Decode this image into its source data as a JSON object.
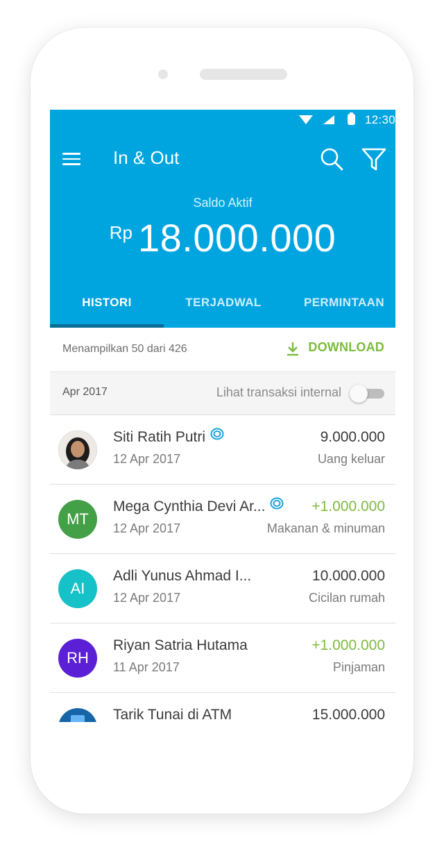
{
  "status_bar": {
    "time": "12:30",
    "icons": [
      "wifi-icon",
      "signal-icon",
      "battery-icon"
    ]
  },
  "toolbar": {
    "title": "In & Out",
    "menu_icon": "menu-icon",
    "search_icon": "search-icon",
    "filter_icon": "filter-icon"
  },
  "balance": {
    "label": "Saldo Aktif",
    "currency": "Rp",
    "amount": "18.000.000"
  },
  "tabs": [
    {
      "label": "HISTORI",
      "active": true
    },
    {
      "label": "TERJADWAL",
      "active": false
    },
    {
      "label": "PERMINTAAN",
      "active": false
    }
  ],
  "summary": {
    "count_text": "Menampilkan 50 dari 426",
    "download_label": "DOWNLOAD",
    "download_icon": "download-icon"
  },
  "section": {
    "month": "Apr 2017",
    "internal_label": "Lihat transaksi internal",
    "toggle_on": false
  },
  "transactions": [
    {
      "name": "Siti Ratih Putri",
      "verified": true,
      "date": "12 Apr 2017",
      "amount": "9.000.000",
      "direction": "out",
      "category": "Uang keluar",
      "avatar_initials": "",
      "avatar_type": "photo"
    },
    {
      "name": "Mega Cynthia Devi Ar...",
      "verified": true,
      "date": "12 Apr 2017",
      "amount": "+1.000.000",
      "direction": "in",
      "category": "Makanan & minuman",
      "avatar_initials": "MT",
      "avatar_color": "#43a047"
    },
    {
      "name": "Adli Yunus Ahmad I...",
      "verified": false,
      "date": "12 Apr 2017",
      "amount": "10.000.000",
      "direction": "out",
      "category": "Cicilan rumah",
      "avatar_initials": "AI",
      "avatar_color": "#16c1c8"
    },
    {
      "name": "Riyan Satria Hutama",
      "verified": false,
      "date": "11 Apr 2017",
      "amount": "+1.000.000",
      "direction": "in",
      "category": "Pinjaman",
      "avatar_initials": "RH",
      "avatar_color": "#5b1fd6"
    },
    {
      "name": "Tarik Tunai di ATM",
      "verified": false,
      "date": "",
      "amount": "15.000.000",
      "direction": "out",
      "category": "",
      "avatar_initials": "",
      "avatar_type": "atm-icon"
    }
  ],
  "colors": {
    "header": "#00a5df",
    "accent_green": "#7cbb3d",
    "tab_indicator": "#0a6c97"
  }
}
